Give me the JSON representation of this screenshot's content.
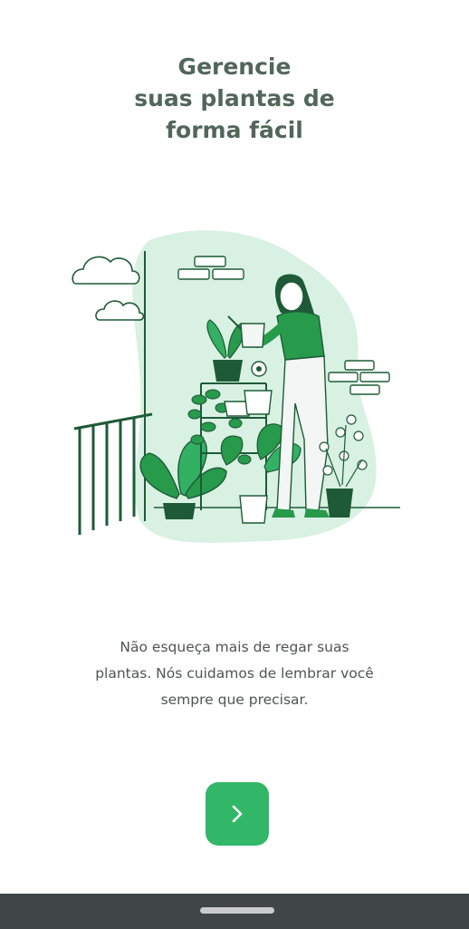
{
  "onboarding": {
    "title": "Gerencie\nsuas plantas de\nforma fácil",
    "description": "Não esqueça mais de regar suas\nplantas. Nós cuidamos de lembrar você\nsempre que precisar.",
    "next_icon": "chevron-right-icon"
  },
  "illustration": {
    "subject": "woman-watering-plants-on-balcony",
    "colors": {
      "accent_green": "#279a4c",
      "dark_green": "#1e5a37",
      "light_green_bg": "#d8f1e2",
      "line": "#1e5a37"
    }
  },
  "colors": {
    "title": "#52665a",
    "text": "#4f5552",
    "button": "#32b768",
    "navbar": "#404548"
  }
}
